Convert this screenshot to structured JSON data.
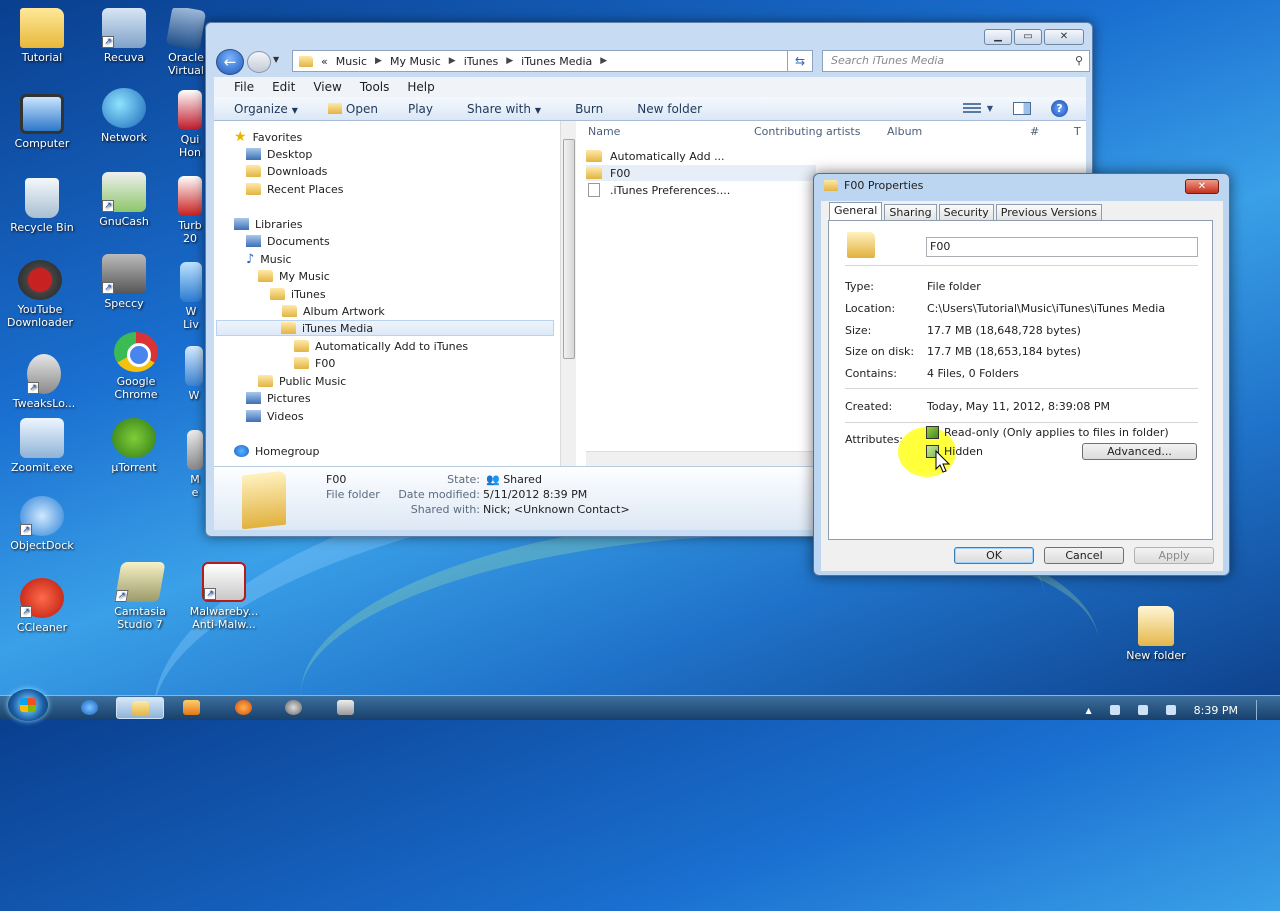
{
  "desktop": {
    "icons": [
      {
        "label": "Tutorial",
        "icon": "folder-icon"
      },
      {
        "label": "Recuva",
        "icon": "recuva-icon"
      },
      {
        "label": "Oracle Virtual",
        "icon": "virtualbox-icon"
      },
      {
        "label": "Computer",
        "icon": "computer-icon"
      },
      {
        "label": "Network",
        "icon": "network-icon"
      },
      {
        "label": "Qui Hon",
        "icon": "quicktime-icon"
      },
      {
        "label": "Recycle Bin",
        "icon": "recycle-bin-icon"
      },
      {
        "label": "GnuCash",
        "icon": "gnucash-icon"
      },
      {
        "label": "Turb 20",
        "icon": "turbotax-icon"
      },
      {
        "label": "YouTube Downloader",
        "icon": "youtube-downloader-icon"
      },
      {
        "label": "Speccy",
        "icon": "speccy-icon"
      },
      {
        "label": "W Liv",
        "icon": "windows-live-icon"
      },
      {
        "label": "TweaksLo...",
        "icon": "tweaks-icon"
      },
      {
        "label": "Google Chrome",
        "icon": "chrome-icon"
      },
      {
        "label": "W",
        "icon": "app-icon"
      },
      {
        "label": "Zoomit.exe",
        "icon": "zoomit-icon"
      },
      {
        "label": "µTorrent",
        "icon": "utorrent-icon"
      },
      {
        "label": "M e",
        "icon": "app-icon"
      },
      {
        "label": "ObjectDock",
        "icon": "objectdock-icon"
      },
      {
        "label": "CCleaner",
        "icon": "ccleaner-icon"
      },
      {
        "label": "Camtasia Studio 7",
        "icon": "camtasia-icon"
      },
      {
        "label": "Malwareby... Anti-Malw...",
        "icon": "malwarebytes-icon"
      },
      {
        "label": "New folder",
        "icon": "new-folder-icon"
      }
    ]
  },
  "explorer": {
    "address": {
      "overflow": "«",
      "crumbs": [
        "Music",
        "My Music",
        "iTunes",
        "iTunes Media"
      ]
    },
    "search_placeholder": "Search iTunes Media",
    "menu": [
      "File",
      "Edit",
      "View",
      "Tools",
      "Help"
    ],
    "commands": {
      "organize": "Organize",
      "open": "Open",
      "play": "Play",
      "share_with": "Share with",
      "burn": "Burn",
      "new_folder": "New folder"
    },
    "tree": [
      {
        "label": "Favorites",
        "kind": "star"
      },
      {
        "label": "Desktop",
        "kind": "folder"
      },
      {
        "label": "Downloads",
        "kind": "folder"
      },
      {
        "label": "Recent Places",
        "kind": "folder"
      },
      {
        "label": "Libraries",
        "kind": "library"
      },
      {
        "label": "Documents",
        "kind": "folder"
      },
      {
        "label": "Music",
        "kind": "music"
      },
      {
        "label": "My Music",
        "kind": "folder"
      },
      {
        "label": "iTunes",
        "kind": "folder"
      },
      {
        "label": "Album Artwork",
        "kind": "folder"
      },
      {
        "label": "iTunes Media",
        "kind": "folder",
        "selected": true
      },
      {
        "label": "Automatically Add to iTunes",
        "kind": "folder"
      },
      {
        "label": "F00",
        "kind": "folder"
      },
      {
        "label": "Public Music",
        "kind": "folder"
      },
      {
        "label": "Pictures",
        "kind": "folder"
      },
      {
        "label": "Videos",
        "kind": "folder"
      },
      {
        "label": "Homegroup",
        "kind": "homegroup"
      }
    ],
    "columns": [
      "Name",
      "Contributing artists",
      "Album",
      "#",
      "T"
    ],
    "files": [
      {
        "name": "Automatically Add ...",
        "kind": "folder"
      },
      {
        "name": "F00",
        "kind": "folder",
        "selected": true
      },
      {
        "name": ".iTunes Preferences....",
        "kind": "file"
      }
    ],
    "details": {
      "name": "F00",
      "type": "File folder",
      "state_label": "State:",
      "state": "Shared",
      "date_label": "Date modified:",
      "date": "5/11/2012 8:39 PM",
      "shared_label": "Shared with:",
      "shared": "Nick; <Unknown Contact>"
    }
  },
  "properties": {
    "title": "F00 Properties",
    "tabs": [
      "General",
      "Sharing",
      "Security",
      "Previous Versions"
    ],
    "name": "F00",
    "rows": {
      "type": {
        "label": "Type:",
        "value": "File folder"
      },
      "location": {
        "label": "Location:",
        "value": "C:\\Users\\Tutorial\\Music\\iTunes\\iTunes Media"
      },
      "size": {
        "label": "Size:",
        "value": "17.7 MB (18,648,728 bytes)"
      },
      "size_on_disk": {
        "label": "Size on disk:",
        "value": "17.7 MB (18,653,184 bytes)"
      },
      "contains": {
        "label": "Contains:",
        "value": "4 Files, 0 Folders"
      },
      "created": {
        "label": "Created:",
        "value": "Today, May 11, 2012, 8:39:08 PM"
      }
    },
    "attributes_label": "Attributes:",
    "readonly_label": "Read-only (Only applies to files in folder)",
    "hidden_label": "Hidden",
    "advanced_button": "Advanced...",
    "ok": "OK",
    "cancel": "Cancel",
    "apply": "Apply"
  },
  "taskbar": {
    "clock": "8:39 PM"
  }
}
